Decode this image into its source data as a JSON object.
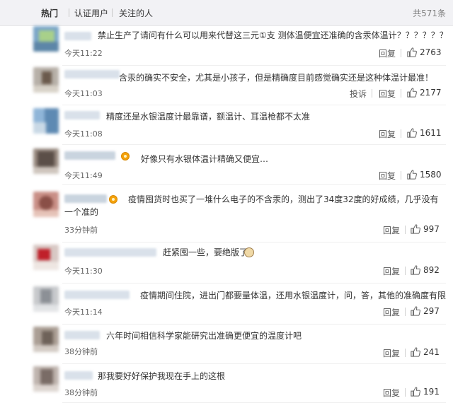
{
  "tabs": [
    "热门",
    "认证用户",
    "关注的人"
  ],
  "total_label": "共571条",
  "actions": {
    "reply": "回复",
    "report": "投诉"
  },
  "comments": [
    {
      "text": "禁止生产了请问有什么可以用来代替这三元①支 测体温便宜还准确的含汞体温计？？？？？？",
      "time": "今天11:22",
      "likes": "2763"
    },
    {
      "text": "含汞的确实不安全，尤其是小孩子，但是精确度目前感觉确实还是这种体温计最准！",
      "time": "今天11:03",
      "likes": "2177"
    },
    {
      "text": "精度还是水银温度计最靠谱，额温计、耳温枪都不太准",
      "time": "今天11:08",
      "likes": "1611"
    },
    {
      "text": "好像只有水银体温计精确又便宜…",
      "time": "今天11:49",
      "likes": "1580"
    },
    {
      "text": "疫情囤货时也买了一堆什么电子的不含汞的，测出了34度32度的好成绩，几乎没有一个准的",
      "time": "33分钟前",
      "likes": "997"
    },
    {
      "text": "赶紧囤一些，要绝版了",
      "time": "今天11:30",
      "likes": "892"
    },
    {
      "text": "疫情期间住院，进出门都要量体温，还用水银温度计，问，答，其他的准确度有限",
      "time": "今天11:14",
      "likes": "297"
    },
    {
      "text": "六年时间相信科学家能研究出准确更便宜的温度计吧",
      "time": "38分钟前",
      "likes": "241"
    },
    {
      "text": "那我要好好保护我现在手上的这根",
      "time": "38分钟前",
      "likes": "191"
    }
  ]
}
